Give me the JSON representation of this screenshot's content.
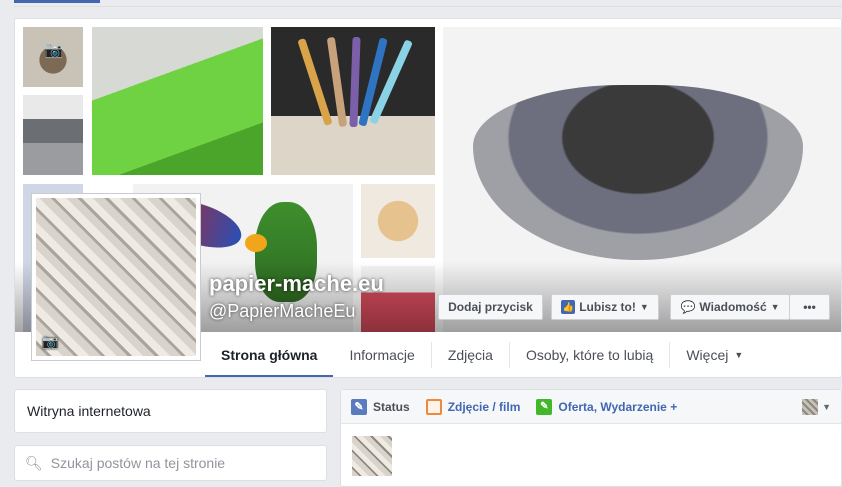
{
  "page": {
    "name": "papier-mache.eu",
    "handle": "@PapierMacheEu"
  },
  "actions": {
    "add_button": "Dodaj przycisk",
    "like_button": "Lubisz to!",
    "message_button": "Wiadomość",
    "more_button": "•••"
  },
  "tabs": [
    {
      "label": "Strona główna",
      "active": true
    },
    {
      "label": "Informacje"
    },
    {
      "label": "Zdjęcia"
    },
    {
      "label": "Osoby, które to lubią"
    },
    {
      "label": "Więcej"
    }
  ],
  "sidebar": {
    "website_label": "Witryna internetowa",
    "search_placeholder": "Szukaj postów na tej stronie"
  },
  "composer": {
    "status_label": "Status",
    "photo_label": "Zdjęcie / film",
    "offer_label": "Oferta, Wydarzenie +"
  },
  "icons": {
    "camera": "camera-icon",
    "like": "thumbs-up-icon",
    "message": "speech-bubble-icon",
    "search": "magnifier-icon",
    "status": "pencil-icon",
    "photo": "photo-icon",
    "offer": "tag-icon"
  },
  "colors": {
    "accent": "#4267b2",
    "background": "#e9ebee",
    "offer_green": "#42b72a",
    "photo_orange": "#f0883a"
  }
}
